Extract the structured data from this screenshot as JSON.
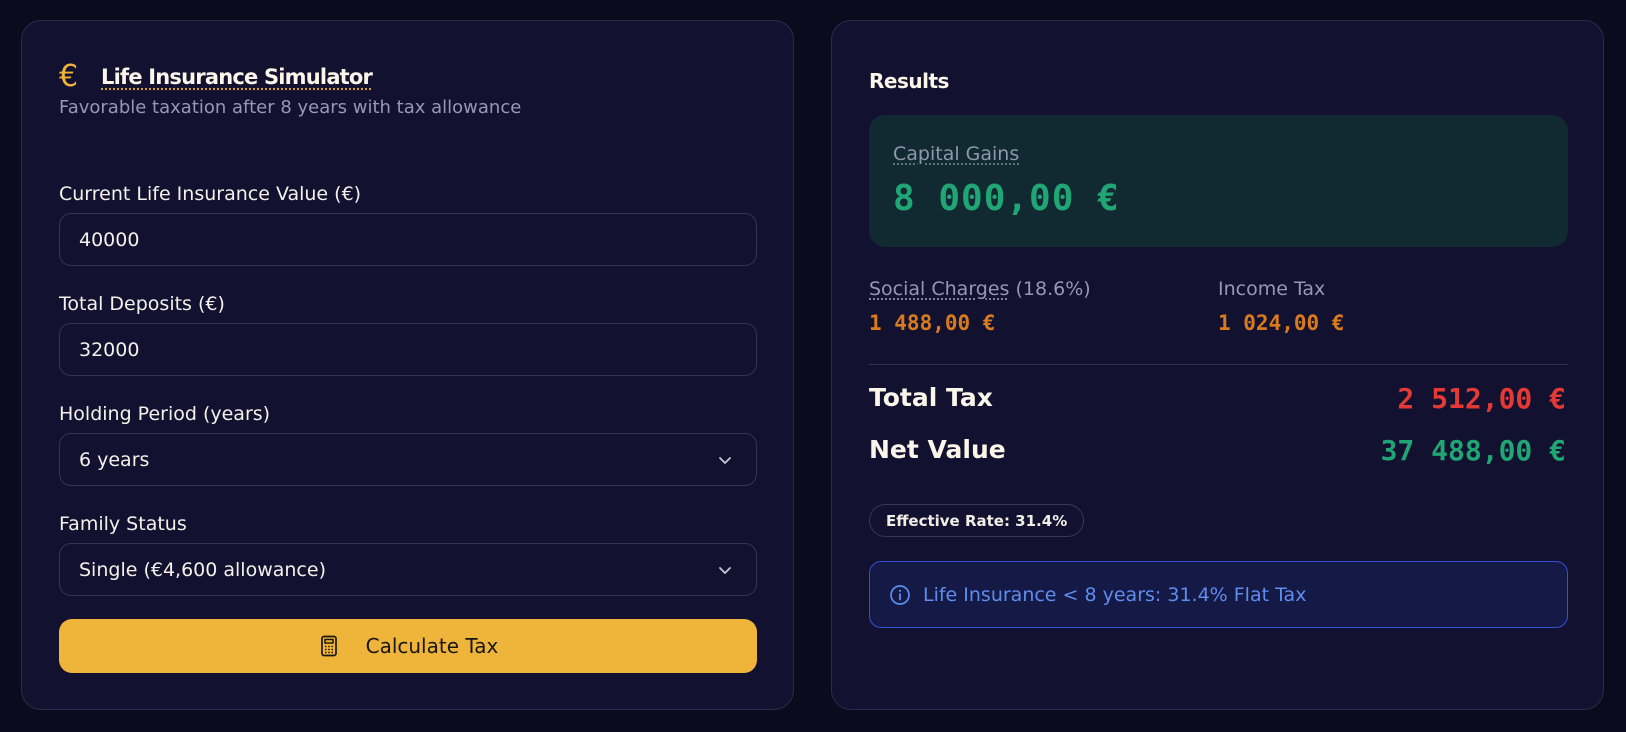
{
  "simulator": {
    "title": "Life Insurance Simulator",
    "title_icon": "euro-icon",
    "subtitle": "Favorable taxation after 8 years with tax allowance",
    "fields": {
      "current_value": {
        "label": "Current Life Insurance Value (€)",
        "value": "40000"
      },
      "total_deposits": {
        "label": "Total Deposits (€)",
        "value": "32000"
      },
      "holding_period": {
        "label": "Holding Period (years)",
        "value": "6 years"
      },
      "family_status": {
        "label": "Family Status",
        "value": "Single (€4,600 allowance)"
      }
    },
    "calculate_button": {
      "label": "Calculate Tax",
      "icon": "calculator-icon"
    }
  },
  "results": {
    "title": "Results",
    "capital_gains": {
      "label": "Capital Gains",
      "value": "8 000,00 €"
    },
    "social_charges": {
      "label": "Social Charges",
      "rate": "(18.6%)",
      "value": "1 488,00 €"
    },
    "income_tax": {
      "label": "Income Tax",
      "value": "1 024,00 €"
    },
    "total_tax": {
      "label": "Total Tax",
      "value": "2 512,00 €"
    },
    "net_value": {
      "label": "Net Value",
      "value": "37 488,00 €"
    },
    "effective_rate": "Effective Rate: 31.4%",
    "info_note": "Life Insurance < 8 years: 31.4% Flat Tax"
  },
  "colors": {
    "background": "#0c0b1e",
    "panel": "#131130",
    "accent": "#efb43a",
    "gains_green": "#1fa674",
    "charges_orange": "#d97b1d",
    "tax_red": "#e53935",
    "info_blue": "#5e8df0"
  }
}
